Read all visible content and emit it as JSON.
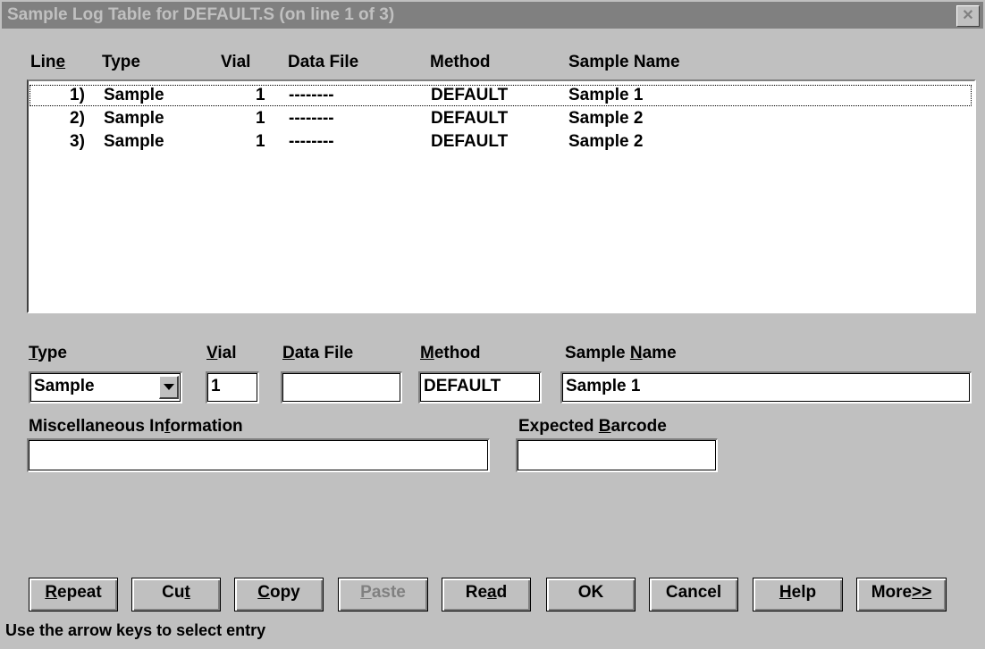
{
  "window": {
    "title": "Sample Log Table for DEFAULT.S (on line 1 of 3)",
    "close_glyph": "✕"
  },
  "columns": {
    "line_pre": "Lin",
    "line_acc": "e",
    "line_post": "",
    "type": "Type",
    "vial": "Vial",
    "data_file": "Data File",
    "method": "Method",
    "sample_name": "Sample Name"
  },
  "rows": [
    {
      "line": "1)",
      "type": "Sample",
      "vial": "1",
      "data_file": "--------",
      "method": "DEFAULT",
      "sample_name": "Sample 1"
    },
    {
      "line": "2)",
      "type": "Sample",
      "vial": "1",
      "data_file": "--------",
      "method": "DEFAULT",
      "sample_name": "Sample 2"
    },
    {
      "line": "3)",
      "type": "Sample",
      "vial": "1",
      "data_file": "--------",
      "method": "DEFAULT",
      "sample_name": "Sample 2"
    }
  ],
  "form": {
    "type": {
      "label_acc": "T",
      "label_post": "ype",
      "value": "Sample",
      "arrow_icon": "down-arrow"
    },
    "vial": {
      "label_acc": "V",
      "label_post": "ial",
      "value": "1"
    },
    "data_file": {
      "label_acc": "D",
      "label_post": "ata File",
      "value": ""
    },
    "method": {
      "label_acc": "M",
      "label_post": "ethod",
      "value": "DEFAULT"
    },
    "sample_name": {
      "label_pre": "Sample ",
      "label_acc": "N",
      "label_post": "ame",
      "value": "Sample 1"
    },
    "misc": {
      "label_pre": "Miscellaneous In",
      "label_acc": "f",
      "label_post": "ormation",
      "value": ""
    },
    "barcode": {
      "label_pre": "Expected ",
      "label_acc": "B",
      "label_post": "arcode",
      "value": ""
    }
  },
  "buttons": [
    {
      "pre": "",
      "acc": "R",
      "post": "epeat"
    },
    {
      "pre": "Cu",
      "acc": "t",
      "post": ""
    },
    {
      "pre": "",
      "acc": "C",
      "post": "opy"
    },
    {
      "pre": "",
      "acc": "P",
      "post": "aste"
    },
    {
      "pre": "Re",
      "acc": "a",
      "post": "d"
    },
    {
      "pre": "OK",
      "acc": "",
      "post": ""
    },
    {
      "pre": "Cancel",
      "acc": "",
      "post": ""
    },
    {
      "pre": "",
      "acc": "H",
      "post": "elp"
    },
    {
      "pre": "More",
      "acc": ">>",
      "post": ""
    }
  ],
  "status": "Use the arrow keys to select entry",
  "colors": {
    "face": "#c0c0c0",
    "title_inactive": "#808080",
    "disabled": "#808080"
  }
}
